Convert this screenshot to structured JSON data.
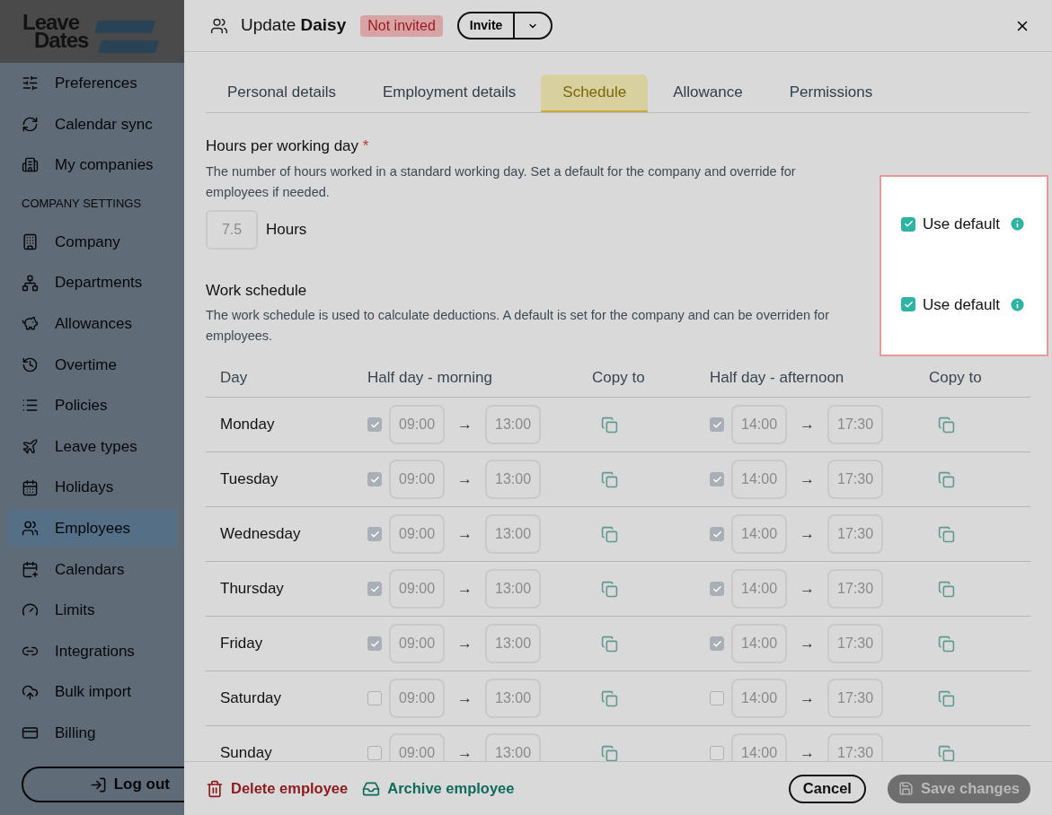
{
  "sidebar": {
    "logo": {
      "line1": "Leave",
      "line2": "Dates"
    },
    "items": [
      {
        "kind": "link",
        "label": "Preferences",
        "selected": false
      },
      {
        "kind": "link",
        "label": "Calendar sync",
        "selected": false
      },
      {
        "kind": "link",
        "label": "My companies",
        "selected": false
      },
      {
        "kind": "heading",
        "label": "COMPANY SETTINGS"
      },
      {
        "kind": "link",
        "label": "Company",
        "selected": false
      },
      {
        "kind": "link",
        "label": "Departments",
        "selected": false
      },
      {
        "kind": "link",
        "label": "Allowances",
        "selected": false
      },
      {
        "kind": "link",
        "label": "Overtime",
        "selected": false
      },
      {
        "kind": "link",
        "label": "Policies",
        "selected": false
      },
      {
        "kind": "link",
        "label": "Leave types",
        "selected": false
      },
      {
        "kind": "link",
        "label": "Holidays",
        "selected": false
      },
      {
        "kind": "link",
        "label": "Employees",
        "selected": true
      },
      {
        "kind": "link",
        "label": "Calendars",
        "selected": false
      },
      {
        "kind": "link",
        "label": "Limits",
        "selected": false
      },
      {
        "kind": "link",
        "label": "Integrations",
        "selected": false
      },
      {
        "kind": "link",
        "label": "Bulk import",
        "selected": false
      },
      {
        "kind": "link",
        "label": "Billing",
        "selected": false
      }
    ],
    "logout": "Log out"
  },
  "dialog": {
    "title": "Update **Daisy**",
    "status_badge": "Not invited",
    "invite_button": "Invite",
    "tabs": [
      {
        "label": "Personal details",
        "selected": false
      },
      {
        "label": "Employment details",
        "selected": false
      },
      {
        "label": "Schedule",
        "selected": true
      },
      {
        "label": "Allowance",
        "selected": false
      },
      {
        "label": "Permissions",
        "selected": false
      }
    ],
    "hours": {
      "title": "Hours per working day",
      "required_mark": "*",
      "description": "The number of hours worked in a standard working day. Set a default for the company and override for employees if needed.",
      "value": "7.5",
      "unit": "Hours"
    },
    "schedule": {
      "title": "Work schedule",
      "description": "The work schedule is used to calculate deductions. A default is set for the company and can be overriden for employees."
    },
    "defaults": [
      {
        "label": "Use default",
        "checked": true
      },
      {
        "label": "Use default",
        "checked": true
      }
    ],
    "table": {
      "columns": [
        "Day",
        "Half day - morning",
        "Copy to",
        "Half day - afternoon",
        "Copy to"
      ],
      "rows": [
        {
          "day": "Monday",
          "morning_checked": true,
          "morning_start": "09:00",
          "morning_end": "13:00",
          "afternoon_checked": true,
          "afternoon_start": "14:00",
          "afternoon_end": "17:30"
        },
        {
          "day": "Tuesday",
          "morning_checked": true,
          "morning_start": "09:00",
          "morning_end": "13:00",
          "afternoon_checked": true,
          "afternoon_start": "14:00",
          "afternoon_end": "17:30"
        },
        {
          "day": "Wednesday",
          "morning_checked": true,
          "morning_start": "09:00",
          "morning_end": "13:00",
          "afternoon_checked": true,
          "afternoon_start": "14:00",
          "afternoon_end": "17:30"
        },
        {
          "day": "Thursday",
          "morning_checked": true,
          "morning_start": "09:00",
          "morning_end": "13:00",
          "afternoon_checked": true,
          "afternoon_start": "14:00",
          "afternoon_end": "17:30"
        },
        {
          "day": "Friday",
          "morning_checked": true,
          "morning_start": "09:00",
          "morning_end": "13:00",
          "afternoon_checked": true,
          "afternoon_start": "14:00",
          "afternoon_end": "17:30"
        },
        {
          "day": "Saturday",
          "morning_checked": false,
          "morning_start": "09:00",
          "morning_end": "13:00",
          "afternoon_checked": false,
          "afternoon_start": "14:00",
          "afternoon_end": "17:30"
        },
        {
          "day": "Sunday",
          "morning_checked": false,
          "morning_start": "09:00",
          "morning_end": "13:00",
          "afternoon_checked": false,
          "afternoon_start": "14:00",
          "afternoon_end": "17:30"
        }
      ],
      "arrow": "→"
    },
    "footer": {
      "delete": "Delete employee",
      "archive": "Archive employee",
      "cancel": "Cancel",
      "save": "Save changes",
      "save_disabled": true
    }
  }
}
